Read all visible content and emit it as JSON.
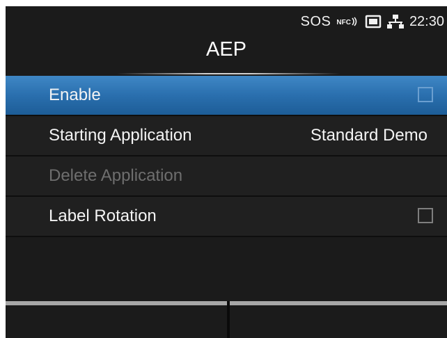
{
  "status_bar": {
    "sos_text": "SOS",
    "nfc_text": "NFC",
    "time": "22:30"
  },
  "header": {
    "title": "AEP"
  },
  "menu": {
    "items": [
      {
        "label": "Enable",
        "type": "checkbox",
        "checked": false,
        "selected": true,
        "enabled": true
      },
      {
        "label": "Starting Application",
        "type": "value",
        "value": "Standard Demo",
        "selected": false,
        "enabled": true
      },
      {
        "label": "Delete Application",
        "type": "action",
        "selected": false,
        "enabled": false
      },
      {
        "label": "Label Rotation",
        "type": "checkbox",
        "checked": false,
        "selected": false,
        "enabled": true
      }
    ]
  },
  "footer": {
    "left_button_label": "",
    "right_button_label": ""
  },
  "colors": {
    "selected_row": "#2a6fae",
    "background": "#1b1b1b",
    "disabled_text": "#6e6e6e"
  }
}
